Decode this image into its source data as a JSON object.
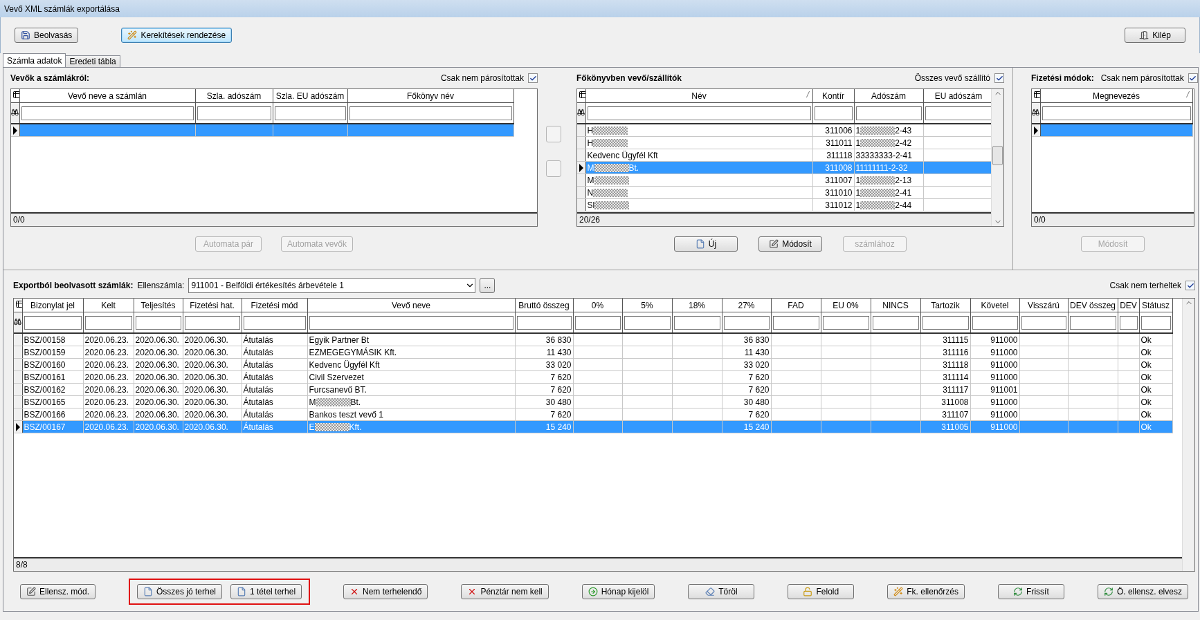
{
  "window": {
    "title": "Vevő XML számlák exportálása"
  },
  "toolbar": {
    "left": [
      {
        "label": "Beolvasás",
        "kind": "save",
        "focused": false
      },
      {
        "label": "Kerekítések rendezése",
        "kind": "wand",
        "focused": true
      }
    ],
    "right": [
      {
        "label": "Kilép",
        "kind": "exit",
        "focused": false
      }
    ]
  },
  "tabs": [
    {
      "label": "Számla adatok",
      "selected": true
    },
    {
      "label": "Eredeti tábla",
      "selected": false
    }
  ],
  "customers_panel": {
    "title": "Vevők a számlákról:",
    "filter": {
      "label": "Csak nem párosítottak",
      "checked": true
    },
    "columns": [
      {
        "label": "Vevő neve a számlán",
        "sorted": false
      },
      {
        "label": "Szla. adószám",
        "sorted": false
      },
      {
        "label": "Szla. EU adószám",
        "sorted": false
      },
      {
        "label": "Főkönyv név",
        "sorted": false
      }
    ],
    "rows": [
      {
        "selected": true,
        "cells": [
          null,
          null,
          null,
          null
        ]
      }
    ],
    "status": "0/0",
    "buttons": [
      {
        "label": "Automata pár",
        "disabled": true
      },
      {
        "label": "Automata vevők",
        "disabled": true
      }
    ]
  },
  "ledger_panel": {
    "title": "Főkönyvben vevő/szállítók",
    "filter": {
      "label": "Összes vevő szállító",
      "checked": true
    },
    "columns": [
      {
        "label": "Név",
        "sorted": true
      },
      {
        "label": "Kontír",
        "sorted": false
      },
      {
        "label": "Adószám",
        "sorted": false
      },
      {
        "label": "EU adószám",
        "sorted": false
      }
    ],
    "rows": [
      {
        "selected": false,
        "cells": [
          [
            "H",
            ""
          ],
          "311006",
          [
            "1",
            "2-43"
          ],
          null
        ]
      },
      {
        "selected": false,
        "cells": [
          [
            "H",
            ""
          ],
          "311011",
          [
            "1",
            "2-42"
          ],
          null
        ]
      },
      {
        "selected": false,
        "cells": [
          "Kedvenc Ügyfél Kft",
          "311118",
          "33333333-2-41",
          null
        ]
      },
      {
        "selected": true,
        "cells": [
          [
            "M",
            "Bt."
          ],
          "311008",
          "11111111-2-32",
          null
        ]
      },
      {
        "selected": false,
        "cells": [
          [
            "M",
            ""
          ],
          "311007",
          [
            "1",
            "2-13"
          ],
          null
        ]
      },
      {
        "selected": false,
        "cells": [
          [
            "N",
            ""
          ],
          "311010",
          [
            "1",
            "2-41"
          ],
          null
        ]
      },
      {
        "selected": false,
        "cells": [
          [
            "Sl",
            ""
          ],
          "311012",
          [
            "1",
            "2-44"
          ],
          null
        ]
      }
    ],
    "status": "20/26",
    "buttons": [
      {
        "label": "Új",
        "kind": "new",
        "disabled": false
      },
      {
        "label": "Módosít",
        "kind": "edit",
        "disabled": false
      },
      {
        "label": "számlához",
        "disabled": true
      }
    ]
  },
  "payment_panel": {
    "title": "Fizetési módok:",
    "filter": {
      "label": "Csak nem párosítottak",
      "checked": true
    },
    "columns": [
      {
        "label": "Megnevezés",
        "sorted": true
      }
    ],
    "rows": [
      {
        "selected": true,
        "cells": [
          null
        ]
      }
    ],
    "status": "0/0",
    "buttons": [
      {
        "label": "Módosít",
        "disabled": true
      }
    ]
  },
  "invoices": {
    "title": "Exportból beolvasott számlák:",
    "account_label": "Ellenszámla:",
    "account_value": "911001 - Belföldi értékesítés árbevétele 1",
    "browse_button": "...",
    "filter": {
      "label": "Csak nem terheltek",
      "checked": true
    },
    "columns": [
      {
        "label": "Bizonylat jel",
        "sorted": false
      },
      {
        "label": "Kelt",
        "sorted": false
      },
      {
        "label": "Teljesítés",
        "sorted": false
      },
      {
        "label": "Fizetési hat.",
        "sorted": false
      },
      {
        "label": "Fizetési mód",
        "sorted": false
      },
      {
        "label": "Vevő neve",
        "sorted": false
      },
      {
        "label": "Bruttó összeg",
        "sorted": false
      },
      {
        "label": "0%",
        "sorted": false
      },
      {
        "label": "5%",
        "sorted": false
      },
      {
        "label": "18%",
        "sorted": false
      },
      {
        "label": "27%",
        "sorted": false
      },
      {
        "label": "FAD",
        "sorted": false
      },
      {
        "label": "EU 0%",
        "sorted": false
      },
      {
        "label": "NINCS",
        "sorted": false
      },
      {
        "label": "Tartozik",
        "sorted": false
      },
      {
        "label": "Követel",
        "sorted": false
      },
      {
        "label": "Visszárú",
        "sorted": false
      },
      {
        "label": "DEV összeg",
        "sorted": false
      },
      {
        "label": "DEV",
        "sorted": false
      },
      {
        "label": "Státusz",
        "sorted": false
      }
    ],
    "rows": [
      {
        "selected": false,
        "cells": [
          "BSZ/00158",
          "2020.06.23.",
          "2020.06.30.",
          "2020.06.30.",
          "Átutalás",
          "Egyik Partner Bt",
          "36 830",
          null,
          null,
          null,
          "36 830",
          null,
          null,
          null,
          "311115",
          "911000",
          null,
          null,
          null,
          "Ok"
        ]
      },
      {
        "selected": false,
        "cells": [
          "BSZ/00159",
          "2020.06.23.",
          "2020.06.30.",
          "2020.06.30.",
          "Átutalás",
          "EZMEGEGYMÁSIK Kft.",
          "11 430",
          null,
          null,
          null,
          "11 430",
          null,
          null,
          null,
          "311116",
          "911000",
          null,
          null,
          null,
          "Ok"
        ]
      },
      {
        "selected": false,
        "cells": [
          "BSZ/00160",
          "2020.06.23.",
          "2020.06.30.",
          "2020.06.30.",
          "Átutalás",
          "Kedvenc Ügyfél Kft",
          "33 020",
          null,
          null,
          null,
          "33 020",
          null,
          null,
          null,
          "311118",
          "911000",
          null,
          null,
          null,
          "Ok"
        ]
      },
      {
        "selected": false,
        "cells": [
          "BSZ/00161",
          "2020.06.23.",
          "2020.06.30.",
          "2020.06.30.",
          "Átutalás",
          "Civil Szervezet",
          "7 620",
          null,
          null,
          null,
          "7 620",
          null,
          null,
          null,
          "311114",
          "911000",
          null,
          null,
          null,
          "Ok"
        ]
      },
      {
        "selected": false,
        "cells": [
          "BSZ/00162",
          "2020.06.23.",
          "2020.06.30.",
          "2020.06.30.",
          "Átutalás",
          "Furcsanevű BT.",
          "7 620",
          null,
          null,
          null,
          "7 620",
          null,
          null,
          null,
          "311117",
          "911001",
          null,
          null,
          null,
          "Ok"
        ]
      },
      {
        "selected": false,
        "cells": [
          "BSZ/00165",
          "2020.06.23.",
          "2020.06.30.",
          "2020.06.30.",
          "Átutalás",
          [
            "M",
            "Bt."
          ],
          "30 480",
          null,
          null,
          null,
          "30 480",
          null,
          null,
          null,
          "311008",
          "911000",
          null,
          null,
          null,
          "Ok"
        ]
      },
      {
        "selected": false,
        "cells": [
          "BSZ/00166",
          "2020.06.23.",
          "2020.06.30.",
          "2020.06.30.",
          "Átutalás",
          "Bankos teszt vevő 1",
          "7 620",
          null,
          null,
          null,
          "7 620",
          null,
          null,
          null,
          "311107",
          "911000",
          null,
          null,
          null,
          "Ok"
        ]
      },
      {
        "selected": true,
        "cells": [
          "BSZ/00167",
          "2020.06.23.",
          "2020.06.30.",
          "2020.06.30.",
          "Átutalás",
          [
            "E",
            "Kft."
          ],
          "15 240",
          null,
          null,
          null,
          "15 240",
          null,
          null,
          null,
          "311005",
          "911000",
          null,
          null,
          null,
          "Ok"
        ]
      }
    ],
    "status": "8/8"
  },
  "bottom_bar": [
    {
      "kind": "edit",
      "label": "Ellensz. mód."
    },
    {
      "kind": "highlight",
      "buttons": [
        {
          "label": "Összes jó terhel",
          "kind": "new"
        },
        {
          "label": "1 tétel terhel",
          "kind": "new"
        }
      ]
    },
    {
      "kind": "cross",
      "label": "Nem terhelendő"
    },
    {
      "kind": "cross",
      "label": "Pénztár nem kell"
    },
    {
      "kind": "go",
      "label": "Hónap kijelöl"
    },
    {
      "kind": "erase",
      "label": "Töröl"
    },
    {
      "kind": "unlock",
      "label": "Felold"
    },
    {
      "kind": "wand",
      "label": "Fk. ellenőrzés"
    },
    {
      "kind": "refresh",
      "label": "Frissít"
    },
    {
      "kind": "refresh",
      "label": "Ö. ellensz. elvesz"
    }
  ]
}
